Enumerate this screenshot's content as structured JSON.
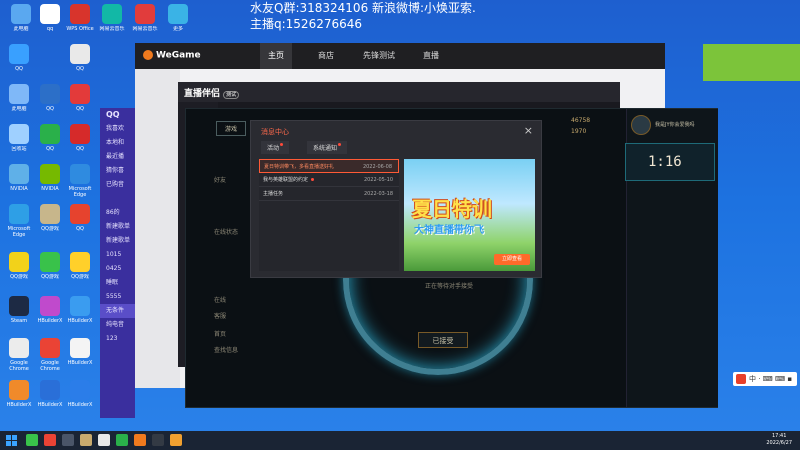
{
  "overlay": {
    "line1": "水友Q群:318324106 新浪微博:小焕亚索.",
    "line2": "主播q:1526276646"
  },
  "wegame": {
    "logo": "WeGame",
    "nav": [
      "主页",
      "商店",
      "先锋测试",
      "直播"
    ]
  },
  "zhibo": {
    "logo": "直播伴侣",
    "badge": "测试"
  },
  "qq_panel": {
    "title": "QQ",
    "items": [
      "我喜欢",
      "本地和",
      "最近播",
      "猜你喜",
      "已购音",
      "86的",
      "新建歌单",
      "新建歌单",
      "1015",
      "0425",
      "睡眠",
      "5555",
      "无条件",
      "纯电音",
      "123"
    ]
  },
  "lol": {
    "tabs": [
      "游戏"
    ],
    "side": [
      "好友",
      "在线状态",
      "在线",
      "客服",
      "首页",
      "查找信息"
    ],
    "gold": "46758",
    "rp": "1970",
    "right_title": "我是JY你会爱我吗",
    "timer": "1:16",
    "accepted": "已接受",
    "match_text": "正在等待对手接受"
  },
  "dialog": {
    "title": "消息中心",
    "tabs": [
      "活动",
      "系统通知"
    ],
    "rows": [
      {
        "text": "夏日特训带飞，多看直播送好礼",
        "date": "2022-06-08",
        "selected": true,
        "dot": false
      },
      {
        "text": "我与英雄联盟的约定",
        "date": "2022-05-10",
        "selected": false,
        "dot": true
      },
      {
        "text": "主播任务",
        "date": "2022-03-18",
        "selected": false,
        "dot": false
      }
    ],
    "banner_title": "夏日特训",
    "banner_sub": "大神直播带你飞",
    "banner_btn": "立即查看"
  },
  "desktop": {
    "row1": [
      "此电脑",
      "qq",
      "WPS Office",
      "网易云音乐",
      "更多"
    ],
    "col_left": [
      "QQ",
      "此电脑",
      "回收站",
      "NVIDIA",
      "Microsoft Edge",
      "QQ游戏",
      "Steam",
      "Google Chrome",
      "HBuilderX"
    ]
  },
  "taskbar": {
    "time": "17:41",
    "date": "2022/6/27"
  },
  "ime": {
    "label": "中 · ⌨ ⌨ ▪"
  },
  "colors": {
    "desktop": "#1d72e0",
    "accent": "#ff5a36",
    "green": "#7cc43a"
  }
}
